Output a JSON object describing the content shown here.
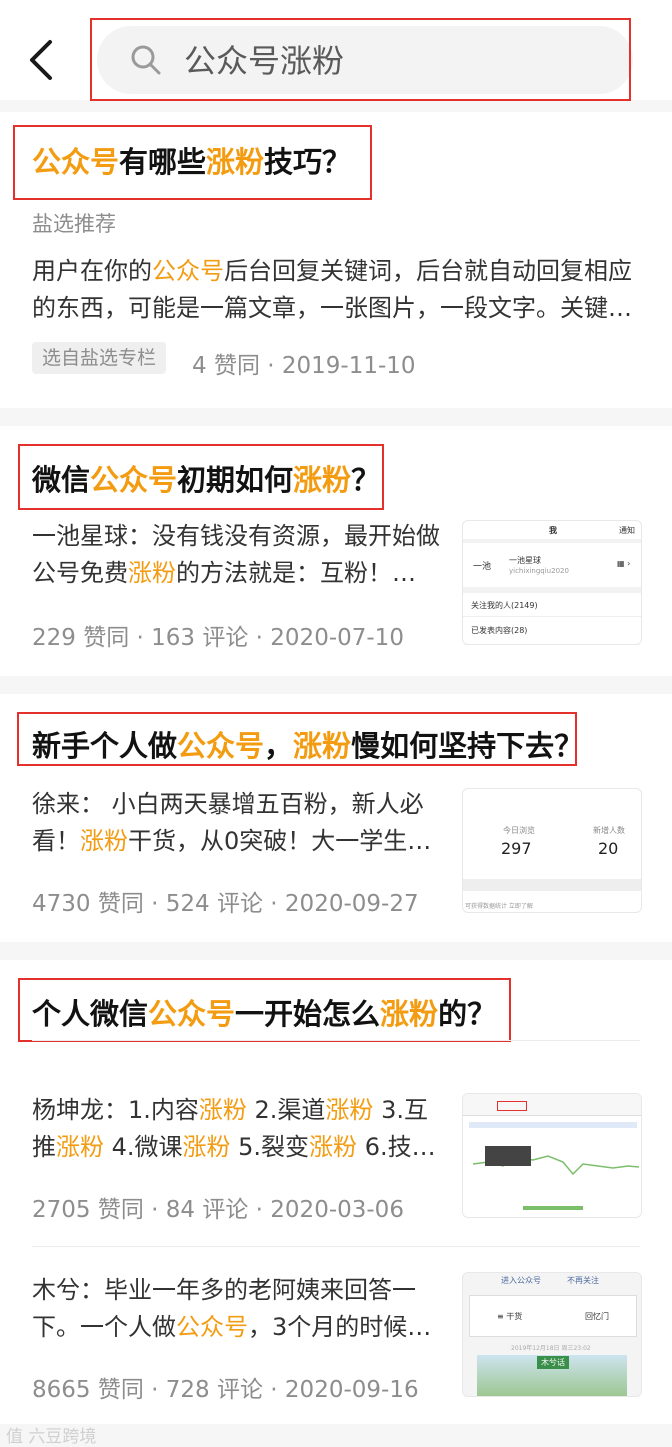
{
  "search": {
    "query": "公众号涨粉"
  },
  "results": [
    {
      "title": [
        "公众号",
        "有哪些",
        "涨粉",
        "技巧？"
      ],
      "source": "盐选推荐",
      "snippet_line1": [
        "用户在你的",
        "公众号",
        "后台回复关键词，后台就自动回复相应"
      ],
      "snippet_line2": "的东西，可能是一篇文章，一张图片，一段文字。关键…",
      "tag": "选自盐选专栏",
      "meta": "4 赞同 · 2019-11-10"
    },
    {
      "title": [
        "微信",
        "公众号",
        "初期如何",
        "涨粉",
        "？"
      ],
      "snippet_line1": "一池星球：没有钱没有资源，最开始做",
      "snippet_line2": [
        "公号免费",
        "涨粉",
        "的方法就是：互粉！…"
      ],
      "meta": "229 赞同 · 163 评论 · 2020-07-10",
      "thumb": {
        "header_title": "我",
        "header_right": "通知",
        "profile_name": "一池星球",
        "profile_id": "yichixingqiu2020",
        "row1": "关注我的人(2149)",
        "row2": "已发表内容(28)"
      }
    },
    {
      "title": [
        "新手个人做",
        "公众号",
        "，",
        "涨粉",
        "慢如何坚持下去？"
      ],
      "snippet_line1": "徐来： 小白两天暴增五百粉，新人必",
      "snippet_line2": [
        "看！",
        "涨粉",
        "干货，从0突破！大一学生…"
      ],
      "meta": "4730 赞同 · 524 评论 · 2020-09-27",
      "thumb": {
        "label1": "今日浏览",
        "value1": "297",
        "label2": "新增人数",
        "value2": "20",
        "footer": "可获得数据统计 立即了解"
      }
    },
    {
      "title": [
        "个人微信",
        "公众号",
        "一开始怎么",
        "涨粉",
        "的？"
      ],
      "snippet_line1": [
        "杨坤龙：1.内容",
        "涨粉",
        " 2.渠道",
        "涨粉",
        " 3.互"
      ],
      "snippet_line2": [
        "推",
        "涨粉",
        " 4.微课",
        "涨粉",
        " 5.裂变",
        "涨粉",
        " 6.技…"
      ],
      "meta": "2705 赞同 · 84 评论 · 2020-03-06"
    },
    {
      "snippet_line1": "木兮：毕业一年多的老阿姨来回答一",
      "snippet_line2": [
        "下。一个人做",
        "公众号",
        "，3个月的时候…"
      ],
      "meta": "8665 赞同 · 728 评论 · 2020-09-16",
      "thumb": {
        "top_left": "进入公众号",
        "top_right": "不再关注",
        "btn1": "≡ 干货",
        "btn2": "回忆门",
        "date": "2019年12月18日 周三23:02",
        "banner": "木兮话"
      }
    }
  ],
  "watermark": "值 六豆跨境",
  "colors": {
    "highlight": "#f39c12",
    "annotation_box": "#e4312b",
    "text": "#121212",
    "meta": "#8d8d8d"
  }
}
